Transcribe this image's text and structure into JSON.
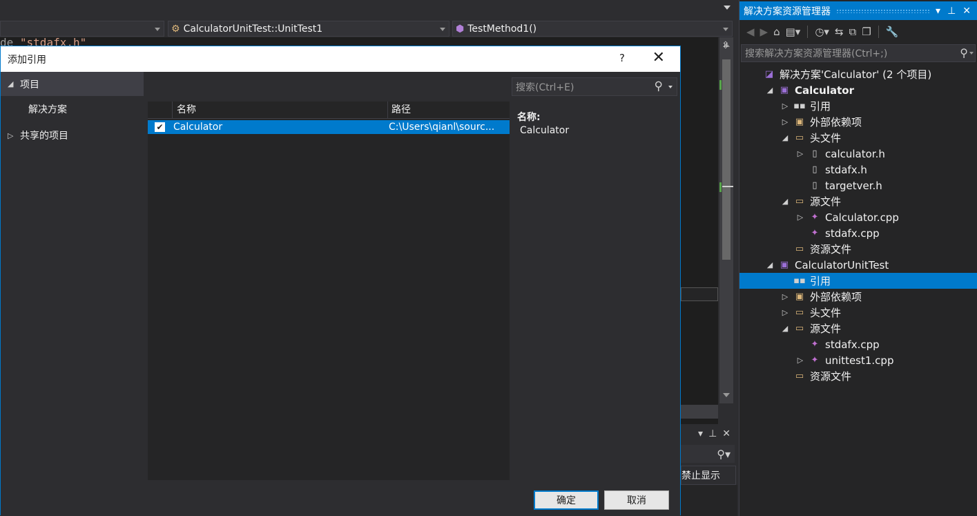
{
  "editor": {
    "nav_combo2": "CalculatorUnitTest::UnitTest1",
    "nav_combo3": "TestMethod1()",
    "code_fragment_kw": "de",
    "code_fragment_str": "\"stdafx.h\"",
    "bottom_panel_label": "禁止显示"
  },
  "solution_explorer": {
    "title": "解决方案资源管理器",
    "search_placeholder": "搜索解决方案资源管理器(Ctrl+;)",
    "tree": [
      {
        "label": "解决方案'Calculator' (2 个项目)",
        "icon": "solution-icon",
        "indent": 0,
        "expander": "",
        "bold": false,
        "selected": false
      },
      {
        "label": "Calculator",
        "icon": "project-icon",
        "indent": 1,
        "expander": "expanded",
        "bold": true,
        "selected": false
      },
      {
        "label": "引用",
        "icon": "references-icon",
        "indent": 2,
        "expander": "collapsed",
        "bold": false,
        "selected": false
      },
      {
        "label": "外部依赖项",
        "icon": "external-deps-icon",
        "indent": 2,
        "expander": "collapsed",
        "bold": false,
        "selected": false
      },
      {
        "label": "头文件",
        "icon": "folder-icon",
        "indent": 2,
        "expander": "expanded",
        "bold": false,
        "selected": false
      },
      {
        "label": "calculator.h",
        "icon": "header-file-icon",
        "indent": 3,
        "expander": "collapsed",
        "bold": false,
        "selected": false
      },
      {
        "label": "stdafx.h",
        "icon": "header-file-icon",
        "indent": 3,
        "expander": "",
        "bold": false,
        "selected": false
      },
      {
        "label": "targetver.h",
        "icon": "header-file-icon",
        "indent": 3,
        "expander": "",
        "bold": false,
        "selected": false
      },
      {
        "label": "源文件",
        "icon": "folder-icon",
        "indent": 2,
        "expander": "expanded",
        "bold": false,
        "selected": false
      },
      {
        "label": "Calculator.cpp",
        "icon": "cpp-file-icon",
        "indent": 3,
        "expander": "collapsed",
        "bold": false,
        "selected": false
      },
      {
        "label": "stdafx.cpp",
        "icon": "cpp-file-icon",
        "indent": 3,
        "expander": "",
        "bold": false,
        "selected": false
      },
      {
        "label": "资源文件",
        "icon": "folder-icon",
        "indent": 2,
        "expander": "",
        "bold": false,
        "selected": false
      },
      {
        "label": "CalculatorUnitTest",
        "icon": "project-icon",
        "indent": 1,
        "expander": "expanded",
        "bold": false,
        "selected": false
      },
      {
        "label": "引用",
        "icon": "references-icon",
        "indent": 2,
        "expander": "",
        "bold": false,
        "selected": true
      },
      {
        "label": "外部依赖项",
        "icon": "external-deps-icon",
        "indent": 2,
        "expander": "collapsed",
        "bold": false,
        "selected": false
      },
      {
        "label": "头文件",
        "icon": "folder-icon",
        "indent": 2,
        "expander": "collapsed",
        "bold": false,
        "selected": false
      },
      {
        "label": "源文件",
        "icon": "folder-icon",
        "indent": 2,
        "expander": "expanded",
        "bold": false,
        "selected": false
      },
      {
        "label": "stdafx.cpp",
        "icon": "cpp-file-icon",
        "indent": 3,
        "expander": "",
        "bold": false,
        "selected": false
      },
      {
        "label": "unittest1.cpp",
        "icon": "cpp-file-icon",
        "indent": 3,
        "expander": "collapsed",
        "bold": false,
        "selected": false
      },
      {
        "label": "资源文件",
        "icon": "folder-icon",
        "indent": 2,
        "expander": "",
        "bold": false,
        "selected": false
      }
    ]
  },
  "dialog": {
    "title": "添加引用",
    "help_label": "?",
    "search_placeholder": "搜索(Ctrl+E)",
    "left_nav": {
      "section": "项目",
      "item_solution": "解决方案",
      "item_shared": "共享的项目"
    },
    "list": {
      "col_name": "名称",
      "col_path": "路径",
      "rows": [
        {
          "name": "Calculator",
          "path": "C:\\Users\\qianl\\sourc...",
          "checked": true
        }
      ]
    },
    "details": {
      "name_key": "名称:",
      "name_value": "Calculator"
    },
    "ok_label": "确定",
    "cancel_label": "取消"
  },
  "colors": {
    "accent": "#007acc",
    "background": "#2d2d30",
    "panel": "#252526"
  }
}
